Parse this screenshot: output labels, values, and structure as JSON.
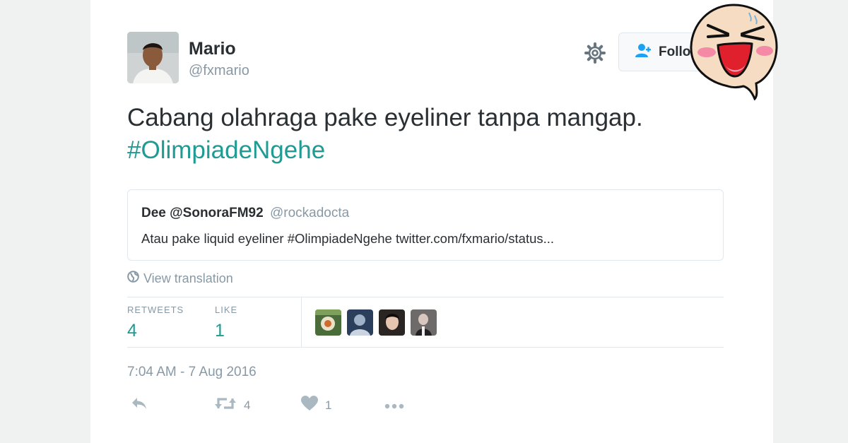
{
  "user": {
    "name": "Mario",
    "handle": "@fxmario"
  },
  "follow_label": "Follo",
  "tweet": {
    "text": "Cabang olahraga pake eyeliner tanpa mangap.",
    "hashtag": "#OlimpiadeNgehe"
  },
  "quote": {
    "name": "Dee @SonoraFM92",
    "handle": "@rockadocta",
    "text": "Atau pake liquid eyeliner #OlimpiadeNgehe twitter.com/fxmario/status..."
  },
  "view_translation": "View translation",
  "stats": {
    "retweets_label": "RETWEETS",
    "retweets": "4",
    "likes_label": "LIKE",
    "likes": "1"
  },
  "timestamp": "7:04 AM - 7 Aug 2016",
  "actions": {
    "retweet_count": "4",
    "like_count": "1"
  },
  "colors": {
    "hashtag": "#1f9b93",
    "muted": "#8899a6",
    "text": "#292f33",
    "border": "#e1e8ed"
  }
}
